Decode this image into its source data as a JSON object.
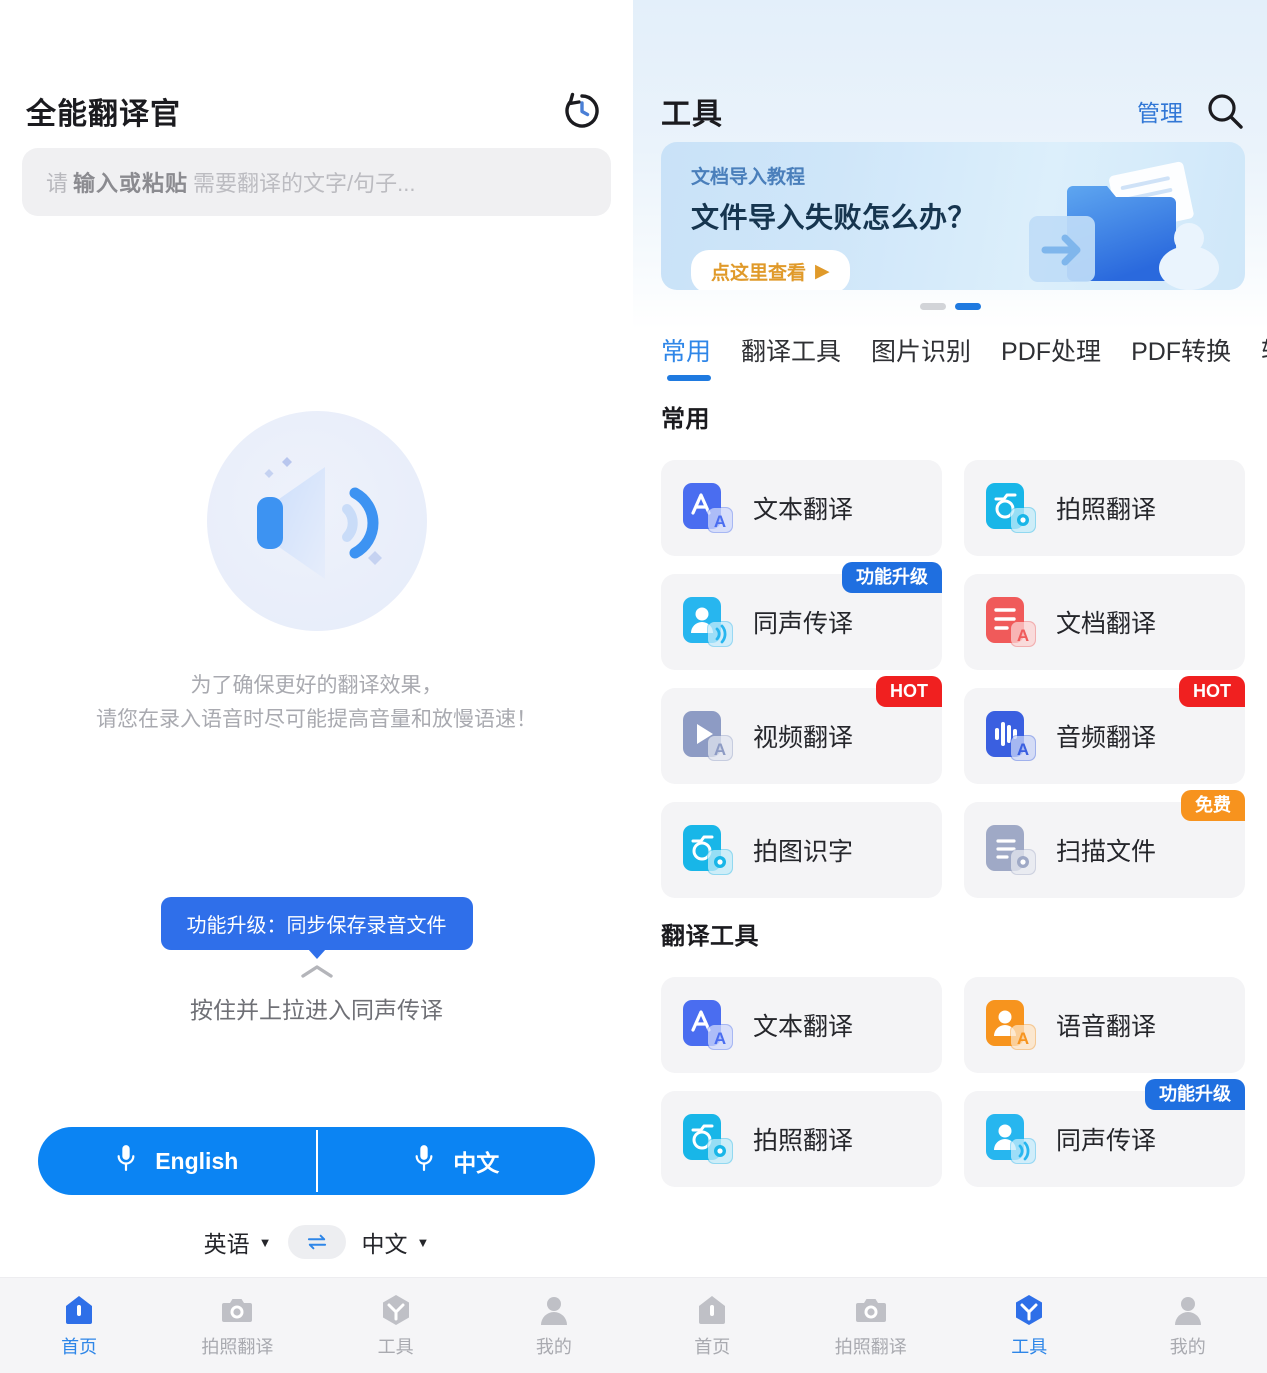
{
  "left": {
    "app_title": "全能翻译官",
    "history_icon": "history-clock-icon",
    "input": {
      "placeholder_light": "请",
      "placeholder_bold": "输入或粘贴",
      "placeholder_rest": "需要翻译的文字/句子..."
    },
    "illustration": "speaker-sound-icon",
    "hint_line1": "为了确保更好的翻译效果，",
    "hint_line2": "请您在录入语音时尽可能提高音量和放慢语速！",
    "upgrade_tip": "功能升级：同步保存录音文件",
    "pull_hint": "按住并上拉进入同声传译",
    "speak_left": "English",
    "speak_right": "中文",
    "lang_from": "英语",
    "lang_to": "中文",
    "swap_icon": "swap-arrows-icon",
    "caret": "▼"
  },
  "right": {
    "title": "工具",
    "manage": "管理",
    "search_icon": "search-icon",
    "banner": {
      "subtitle": "文档导入教程",
      "title": "文件导入失败怎么办？",
      "cta": "点这里查看",
      "cta_arrow": "▶",
      "art": "folder-import-illustration"
    },
    "dots": [
      {
        "active": false
      },
      {
        "active": true
      }
    ],
    "tabs": [
      {
        "label": "常用",
        "active": true
      },
      {
        "label": "翻译工具",
        "active": false
      },
      {
        "label": "图片识别",
        "active": false
      },
      {
        "label": "PDF处理",
        "active": false
      },
      {
        "label": "PDF转换",
        "active": false
      },
      {
        "label": "转",
        "active": false
      }
    ],
    "sections": [
      {
        "title": "常用",
        "cards": [
          {
            "label": "文本翻译",
            "icon": "text-translate-icon",
            "icon_color": "#4a6df0",
            "badge": null
          },
          {
            "label": "拍照翻译",
            "icon": "photo-translate-icon",
            "icon_color": "#18b6e8",
            "badge": null
          },
          {
            "label": "同声传译",
            "icon": "simultaneous-interpretation-icon",
            "icon_color": "#27b6ef",
            "badge": {
              "text": "功能升级",
              "style": "blue"
            }
          },
          {
            "label": "文档翻译",
            "icon": "document-translate-icon",
            "icon_color": "#f05a5a",
            "badge": null
          },
          {
            "label": "视频翻译",
            "icon": "video-translate-icon",
            "icon_color": "#8d9bc4",
            "badge": {
              "text": "HOT",
              "style": "red"
            }
          },
          {
            "label": "音频翻译",
            "icon": "audio-translate-icon",
            "icon_color": "#3a5fe0",
            "badge": {
              "text": "HOT",
              "style": "red"
            }
          },
          {
            "label": "拍图识字",
            "icon": "image-ocr-icon",
            "icon_color": "#18b6e8",
            "badge": null
          },
          {
            "label": "扫描文件",
            "icon": "scan-document-icon",
            "icon_color": "#9fa9c6",
            "badge": {
              "text": "免费",
              "style": "orange"
            }
          }
        ]
      },
      {
        "title": "翻译工具",
        "cards": [
          {
            "label": "文本翻译",
            "icon": "text-translate-icon",
            "icon_color": "#4a6df0",
            "badge": null
          },
          {
            "label": "语音翻译",
            "icon": "voice-translate-icon",
            "icon_color": "#f7941e",
            "badge": null
          },
          {
            "label": "拍照翻译",
            "icon": "photo-translate-icon",
            "icon_color": "#18b6e8",
            "badge": null
          },
          {
            "label": "同声传译",
            "icon": "simultaneous-interpretation-icon",
            "icon_color": "#27b6ef",
            "badge": {
              "text": "功能升级",
              "style": "blue"
            }
          }
        ]
      }
    ]
  },
  "nav_left": [
    {
      "label": "首页",
      "icon": "home-icon",
      "active": true
    },
    {
      "label": "拍照翻译",
      "icon": "camera-icon",
      "active": false
    },
    {
      "label": "工具",
      "icon": "toolbox-icon",
      "active": false
    },
    {
      "label": "我的",
      "icon": "profile-icon",
      "active": false
    }
  ],
  "nav_right": [
    {
      "label": "首页",
      "icon": "home-icon",
      "active": false
    },
    {
      "label": "拍照翻译",
      "icon": "camera-icon",
      "active": false
    },
    {
      "label": "工具",
      "icon": "toolbox-icon",
      "active": true
    },
    {
      "label": "我的",
      "icon": "profile-icon",
      "active": false
    }
  ],
  "colors": {
    "accent": "#0b84f3",
    "tab_active": "#2e86e8",
    "badge_blue": "#1f6fe0",
    "badge_red": "#f02020",
    "badge_orange": "#f7931e"
  }
}
